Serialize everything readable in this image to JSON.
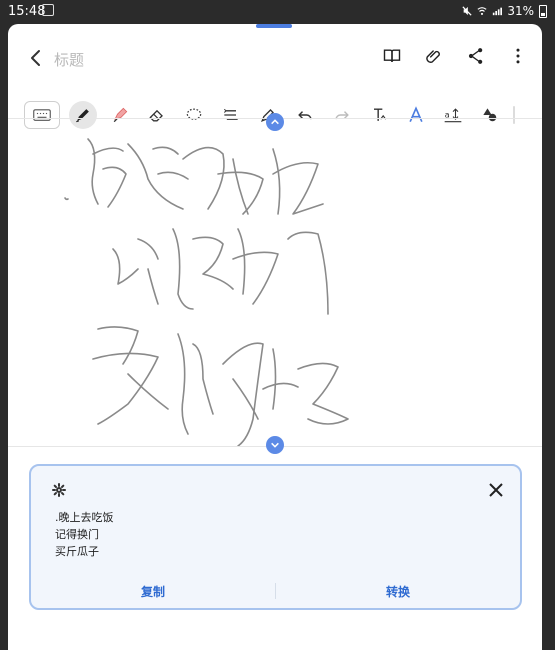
{
  "status": {
    "time": "15:48",
    "battery_text": "31%"
  },
  "note": {
    "title_placeholder": "标题"
  },
  "recognition_panel": {
    "lines": [
      ".晚上去吃饭",
      "记得换门",
      "买斤瓜子"
    ],
    "copy_label": "复制",
    "convert_label": "转换"
  },
  "colors": {
    "accent": "#5c8ae6",
    "panel_border": "#a7c3ee",
    "panel_bg": "#f2f6fc",
    "action_text": "#2f6bd1"
  }
}
